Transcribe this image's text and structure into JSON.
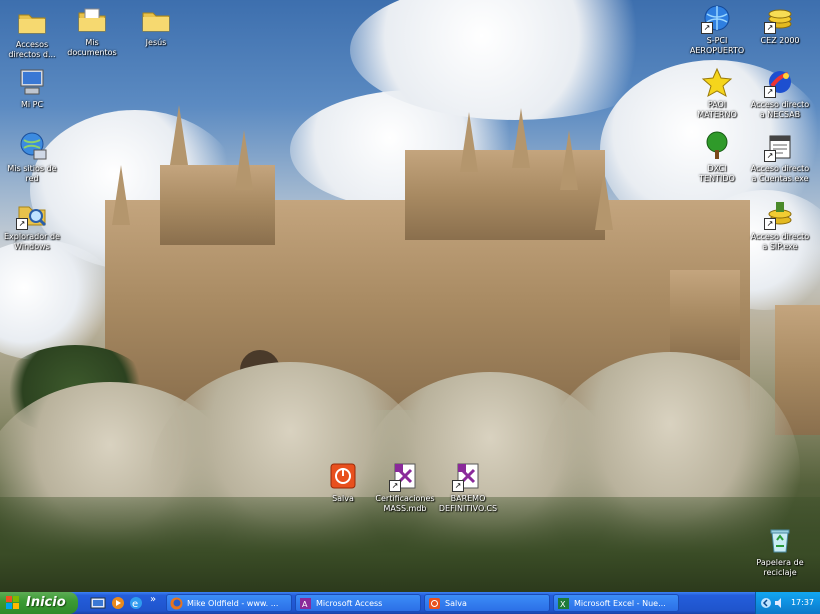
{
  "desktop": {
    "icons": [
      {
        "name": "accesos-directos-folder-icon",
        "label": "Accesos\ndirectos d...",
        "kind": "folder"
      },
      {
        "name": "mis-documentos-icon",
        "label": "Mis\ndocumentos",
        "kind": "mydocs"
      },
      {
        "name": "jesus-folder-icon",
        "label": "Jesús",
        "kind": "folder"
      },
      {
        "name": "mi-pc-icon",
        "label": "Mi PC",
        "kind": "mypc"
      },
      {
        "name": "mis-sitios-de-red-icon",
        "label": "Mis sitios de\nred",
        "kind": "network"
      },
      {
        "name": "explorador-de-windows-icon",
        "label": "Explorador de\nWindows",
        "kind": "explorer"
      },
      {
        "name": "s-pci-aeropuerto-icon",
        "label": "S-PCI\nAEROPUERTO",
        "kind": "globe"
      },
      {
        "name": "cez-2000-icon",
        "label": "CEZ 2000",
        "kind": "coins"
      },
      {
        "name": "paoi-materno-icon",
        "label": "PAOI\nMATERNO",
        "kind": "star"
      },
      {
        "name": "acceso-directo-necsab-icon",
        "label": "Acceso directo\na NECSAB",
        "kind": "app"
      },
      {
        "name": "dxci-tentido-icon",
        "label": "DXCI\nTENTIDO",
        "kind": "tree"
      },
      {
        "name": "acceso-directo-cuentas-icon",
        "label": "Acceso directo\na Cuentas.exe",
        "kind": "doc"
      },
      {
        "name": "acceso-directo-sip-icon",
        "label": "Acceso directo\na SIP.exe",
        "kind": "coins"
      },
      {
        "name": "salva-icon",
        "label": "Salva",
        "kind": "power"
      },
      {
        "name": "certificaciones-mass-icon",
        "label": "Certificaciones\nMASS.mdb",
        "kind": "mdb"
      },
      {
        "name": "baremo-definitivo-icon",
        "label": "BAREMO\nDEFINITIVO.CS",
        "kind": "mdb"
      },
      {
        "name": "papelera-de-reciclaje-icon",
        "label": "Papelera de\nreciclaje",
        "kind": "recycle"
      }
    ]
  },
  "taskbar": {
    "start_label": "Inicio",
    "tasks": [
      {
        "label": "Mike Oldfield - www. ...",
        "icon": "firefox-icon"
      },
      {
        "label": "Microsoft Access",
        "icon": "access-icon"
      },
      {
        "label": "Salva",
        "icon": "salva-task-icon"
      },
      {
        "label": "Microsoft Excel - Nue...",
        "icon": "excel-icon"
      }
    ],
    "quicklaunch_more": "»",
    "clock": "17:37"
  },
  "colors": {
    "taskbar": "#245edb",
    "start": "#3c9b34",
    "tray": "#0f8fe0"
  }
}
